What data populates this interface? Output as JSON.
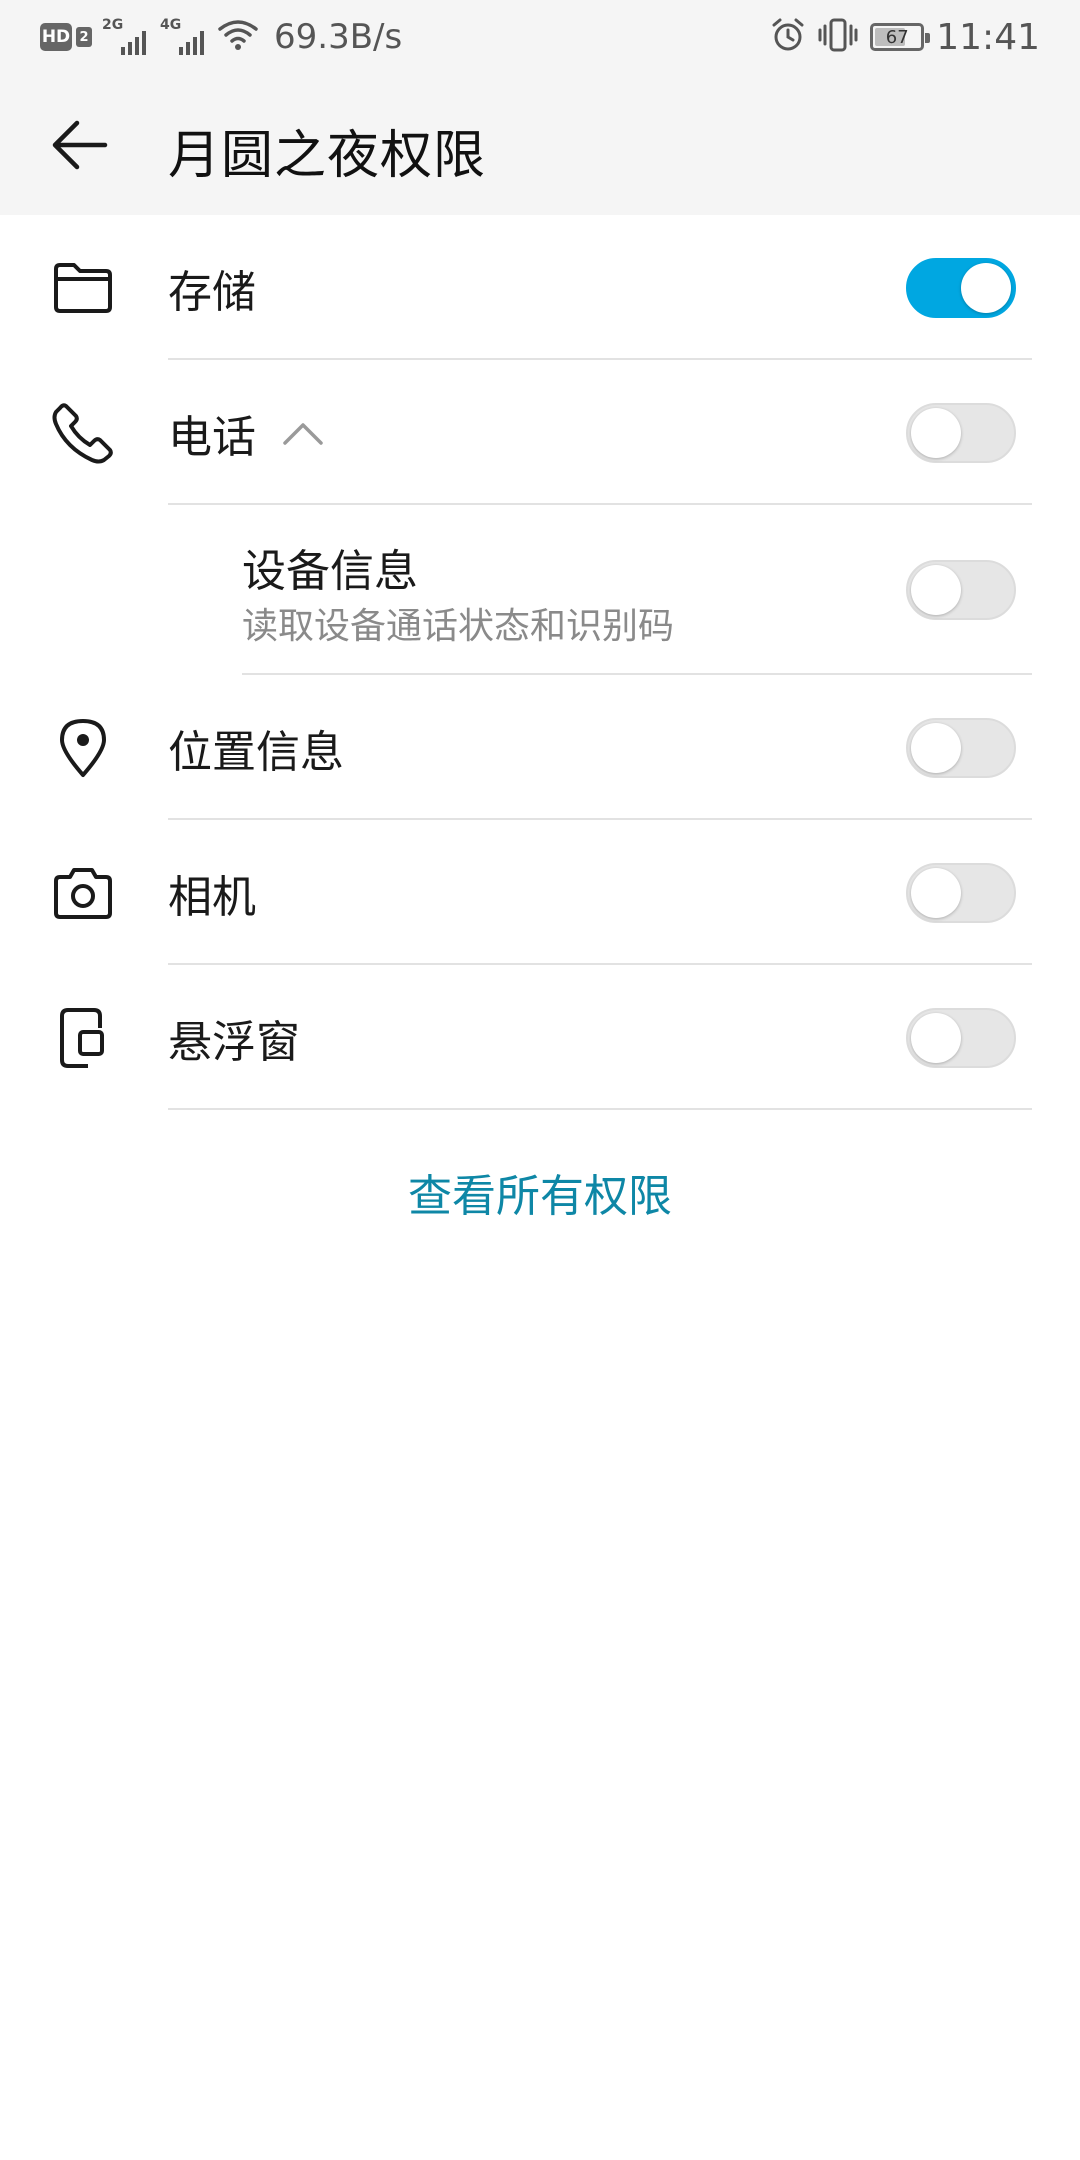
{
  "status_bar": {
    "hd_label": "HD",
    "sim_label": "2",
    "net1_tag": "2G",
    "net2_tag": "4G",
    "speed": "69.3B/s",
    "battery": "67",
    "battery_level": 67,
    "time": "11:41",
    "icons": [
      "hd-icon",
      "signal-icon",
      "wifi-icon",
      "alarm-icon",
      "vibrate-icon",
      "battery-icon"
    ]
  },
  "header": {
    "back_icon": "back-arrow-icon",
    "title": "月圆之夜权限"
  },
  "permissions": [
    {
      "label": "存储",
      "icon": "folder-icon",
      "enabled": true
    },
    {
      "label": "电话",
      "icon": "phone-icon",
      "enabled": false,
      "expanded": true,
      "children": [
        {
          "title": "设备信息",
          "description": "读取设备通话状态和识别码",
          "enabled": false
        }
      ]
    },
    {
      "label": "位置信息",
      "icon": "location-pin-icon",
      "enabled": false
    },
    {
      "label": "相机",
      "icon": "camera-icon",
      "enabled": false
    },
    {
      "label": "悬浮窗",
      "icon": "floating-window-icon",
      "enabled": false
    }
  ],
  "view_all_label": "查看所有权限",
  "colors": {
    "accent": "#00a7e1",
    "link": "#0e87a6",
    "toggle_off": "#e6e6e6",
    "background": "#ffffff",
    "header_bg": "#f5f5f5"
  }
}
